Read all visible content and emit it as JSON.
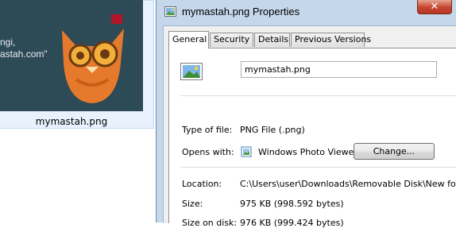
{
  "explorer": {
    "thumbnail_text": "ngi,\nastah.com\"",
    "selected_file": "mymastah.png"
  },
  "dialog": {
    "title": "mymastah.png Properties",
    "close_label": "✕",
    "tabs": [
      {
        "label": "General",
        "active": true
      },
      {
        "label": "Security",
        "active": false
      },
      {
        "label": "Details",
        "active": false
      },
      {
        "label": "Previous Versions",
        "active": false
      }
    ],
    "general": {
      "file_name": "mymastah.png",
      "type_label": "Type of file:",
      "type_value": "PNG File (.png)",
      "opens_label": "Opens with:",
      "opens_value": "Windows Photo Viewer",
      "change_label": "Change...",
      "location_label": "Location:",
      "location_value": "C:\\Users\\user\\Downloads\\Removable Disk\\New fo",
      "size_label": "Size:",
      "size_value": "975 KB (998.592 bytes)",
      "size_on_disk_label": "Size on disk:",
      "size_on_disk_value": "976 KB (999.424 bytes)"
    }
  },
  "colors": {
    "dialog_frame": "#c5d7ea",
    "close_button": "#c5452f",
    "thumbnail_bg": "#2d4a57",
    "mascot_orange": "#e57a2c"
  }
}
